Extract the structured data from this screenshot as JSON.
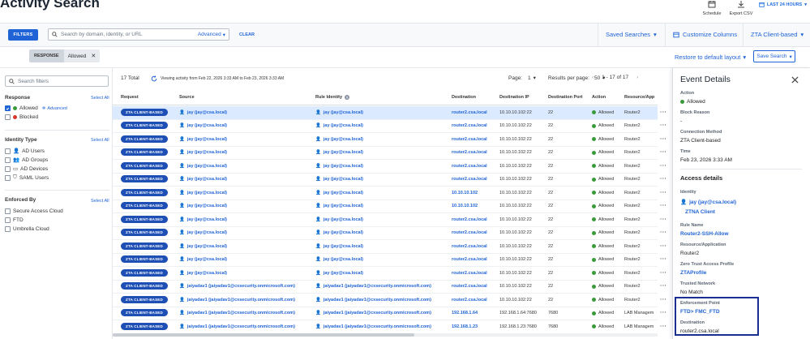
{
  "header": {
    "title": "Activity Search",
    "schedule_label": "Schedule",
    "export_label": "Export CSV",
    "time_range": "LAST 24 HOURS"
  },
  "filter_bar": {
    "filters_button": "FILTERS",
    "search_placeholder": "Search by domain, identity, or URL",
    "advanced_label": "Advanced",
    "clear_label": "CLEAR",
    "saved_searches": "Saved Searches",
    "customize_columns": "Customize Columns",
    "view_select": "ZTA Client-based"
  },
  "chips": {
    "key": "RESPONSE",
    "value": "Allowed",
    "restore_default": "Restore to default layout",
    "save_search": "Save Search"
  },
  "left_panel": {
    "search_placeholder": "Search filters",
    "select_all": "Select All",
    "response": {
      "title": "Response",
      "items": [
        {
          "label": "Allowed",
          "checked": true,
          "dot": "#3a9a3a"
        },
        {
          "label": "Blocked",
          "checked": false,
          "dot": "#d9352b"
        }
      ],
      "advanced_label": "Advanced"
    },
    "identity_type": {
      "title": "Identity Type",
      "items": [
        "AD Users",
        "AD Groups",
        "AD Devices",
        "SAML Users"
      ]
    },
    "enforced_by": {
      "title": "Enforced By",
      "items": [
        "Secure Access Cloud",
        "FTD",
        "Umbrella Cloud"
      ]
    }
  },
  "results": {
    "total": "17 Total",
    "viewing": "Viewing activity from Feb 22, 2026 3:33 AM to Feb 23, 2026 3:33 AM",
    "page_label": "Page:",
    "page_value": "1",
    "per_page_label": "Results per page:",
    "per_page_value": "50",
    "range": "1 - 17 of 17"
  },
  "table": {
    "columns": [
      "Request",
      "Source",
      "Rule Identity",
      "Destination",
      "Destination IP",
      "Destination Port",
      "Action",
      "Resource/App"
    ],
    "rows": [
      {
        "request": "ZTA CLIENT-BASED",
        "source": "jay (jay@csa.local)",
        "rule_identity": "jay (jay@csa.local)",
        "destination": "router2.csa.local",
        "dest_ip": "10.10.10.102:22",
        "dest_port": "22",
        "action": "Allowed",
        "resource": "Router2"
      },
      {
        "request": "ZTA CLIENT-BASED",
        "source": "jay (jay@csa.local)",
        "rule_identity": "jay (jay@csa.local)",
        "destination": "router2.csa.local",
        "dest_ip": "10.10.10.102:22",
        "dest_port": "22",
        "action": "Allowed",
        "resource": "Router2"
      },
      {
        "request": "ZTA CLIENT-BASED",
        "source": "jay (jay@csa.local)",
        "rule_identity": "jay (jay@csa.local)",
        "destination": "router2.csa.local",
        "dest_ip": "10.10.10.102:22",
        "dest_port": "22",
        "action": "Allowed",
        "resource": "Router2"
      },
      {
        "request": "ZTA CLIENT-BASED",
        "source": "jay (jay@csa.local)",
        "rule_identity": "jay (jay@csa.local)",
        "destination": "router2.csa.local",
        "dest_ip": "10.10.10.102:22",
        "dest_port": "22",
        "action": "Allowed",
        "resource": "Router2"
      },
      {
        "request": "ZTA CLIENT-BASED",
        "source": "jay (jay@csa.local)",
        "rule_identity": "jay (jay@csa.local)",
        "destination": "router2.csa.local",
        "dest_ip": "10.10.10.102:22",
        "dest_port": "22",
        "action": "Allowed",
        "resource": "Router2"
      },
      {
        "request": "ZTA CLIENT-BASED",
        "source": "jay (jay@csa.local)",
        "rule_identity": "jay (jay@csa.local)",
        "destination": "router2.csa.local",
        "dest_ip": "10.10.10.102:22",
        "dest_port": "22",
        "action": "Allowed",
        "resource": "Router2"
      },
      {
        "request": "ZTA CLIENT-BASED",
        "source": "jay (jay@csa.local)",
        "rule_identity": "jay (jay@csa.local)",
        "destination": "10.10.10.102",
        "dest_ip": "10.10.10.102:22",
        "dest_port": "22",
        "action": "Allowed",
        "resource": "Router2"
      },
      {
        "request": "ZTA CLIENT-BASED",
        "source": "jay (jay@csa.local)",
        "rule_identity": "jay (jay@csa.local)",
        "destination": "10.10.10.102",
        "dest_ip": "10.10.10.102:22",
        "dest_port": "22",
        "action": "Allowed",
        "resource": "Router2"
      },
      {
        "request": "ZTA CLIENT-BASED",
        "source": "jay (jay@csa.local)",
        "rule_identity": "jay (jay@csa.local)",
        "destination": "router2.csa.local",
        "dest_ip": "10.10.10.102:22",
        "dest_port": "22",
        "action": "Allowed",
        "resource": "Router2"
      },
      {
        "request": "ZTA CLIENT-BASED",
        "source": "jay (jay@csa.local)",
        "rule_identity": "jay (jay@csa.local)",
        "destination": "router2.csa.local",
        "dest_ip": "10.10.10.102:22",
        "dest_port": "22",
        "action": "Allowed",
        "resource": "Router2"
      },
      {
        "request": "ZTA CLIENT-BASED",
        "source": "jay (jay@csa.local)",
        "rule_identity": "jay (jay@csa.local)",
        "destination": "router2.csa.local",
        "dest_ip": "10.10.10.102:22",
        "dest_port": "22",
        "action": "Allowed",
        "resource": "Router2"
      },
      {
        "request": "ZTA CLIENT-BASED",
        "source": "jay (jay@csa.local)",
        "rule_identity": "jay (jay@csa.local)",
        "destination": "router2.csa.local",
        "dest_ip": "10.10.10.102:22",
        "dest_port": "22",
        "action": "Allowed",
        "resource": "Router2"
      },
      {
        "request": "ZTA CLIENT-BASED",
        "source": "jay (jay@csa.local)",
        "rule_identity": "jay (jay@csa.local)",
        "destination": "router2.csa.local",
        "dest_ip": "10.10.10.102:22",
        "dest_port": "22",
        "action": "Allowed",
        "resource": "Router2"
      },
      {
        "request": "ZTA CLIENT-BASED",
        "source": "jaiyadav1 (jaiyadav1@cxsecurity.onmicrosoft.com)",
        "rule_identity": "jaiyadav1 (jaiyadav1@cxsecurity.onmicrosoft.com)",
        "destination": "router2.csa.local",
        "dest_ip": "10.10.10.102:22",
        "dest_port": "22",
        "action": "Allowed",
        "resource": "Router2"
      },
      {
        "request": "ZTA CLIENT-BASED",
        "source": "jaiyadav1 (jaiyadav1@cxsecurity.onmicrosoft.com)",
        "rule_identity": "jaiyadav1 (jaiyadav1@cxsecurity.onmicrosoft.com)",
        "destination": "router2.csa.local",
        "dest_ip": "10.10.10.102:22",
        "dest_port": "22",
        "action": "Allowed",
        "resource": "Router2"
      },
      {
        "request": "ZTA CLIENT-BASED",
        "source": "jaiyadav1 (jaiyadav1@cxsecurity.onmicrosoft.com)",
        "rule_identity": "jaiyadav1 (jaiyadav1@cxsecurity.onmicrosoft.com)",
        "destination": "192.168.1.64",
        "dest_ip": "192.168.1.64:7680",
        "dest_port": "7680",
        "action": "Allowed",
        "resource": "LAB Managem"
      },
      {
        "request": "ZTA CLIENT-BASED",
        "source": "jaiyadav1 (jaiyadav1@cxsecurity.onmicrosoft.com)",
        "rule_identity": "jaiyadav1 (jaiyadav1@cxsecurity.onmicrosoft.com)",
        "destination": "192.168.1.23",
        "dest_ip": "192.168.1.23:7680",
        "dest_port": "7680",
        "action": "Allowed",
        "resource": "LAB Managem"
      }
    ]
  },
  "details": {
    "title": "Event Details",
    "action_label": "Action",
    "action_value": "Allowed",
    "block_reason_label": "Block Reason",
    "block_reason_value": "-",
    "connection_method_label": "Connection Method",
    "connection_method_value": "ZTA Client-based",
    "time_label": "Time",
    "time_value": "Feb 23, 2026 3:33 AM",
    "access_title": "Access details",
    "identity_label": "Identity",
    "identity_value": "jay (jay@csa.local)",
    "identity_sub": "ZTNA Client",
    "rule_name_label": "Rule Name",
    "rule_name_value": "Router2-SSH-Allow",
    "resource_label": "Resource/Application",
    "resource_value": "Router2",
    "ztap_label": "Zero Trust Access Profile",
    "ztap_value": "ZTAProfile",
    "trusted_label": "Trusted Network",
    "trusted_value": "No Match",
    "enforcement_label": "Enforcement Point",
    "enforcement_value": "FTD> FMC_FTD",
    "destination_label": "Destination",
    "destination_value": "router2.csa.local"
  },
  "colors": {
    "accent": "#1f63d6",
    "pill": "#1e4fb5",
    "selected_row": "#dbeaff",
    "allowed_green": "#3a9a3a",
    "highlight_box": "#1a2f8f"
  }
}
